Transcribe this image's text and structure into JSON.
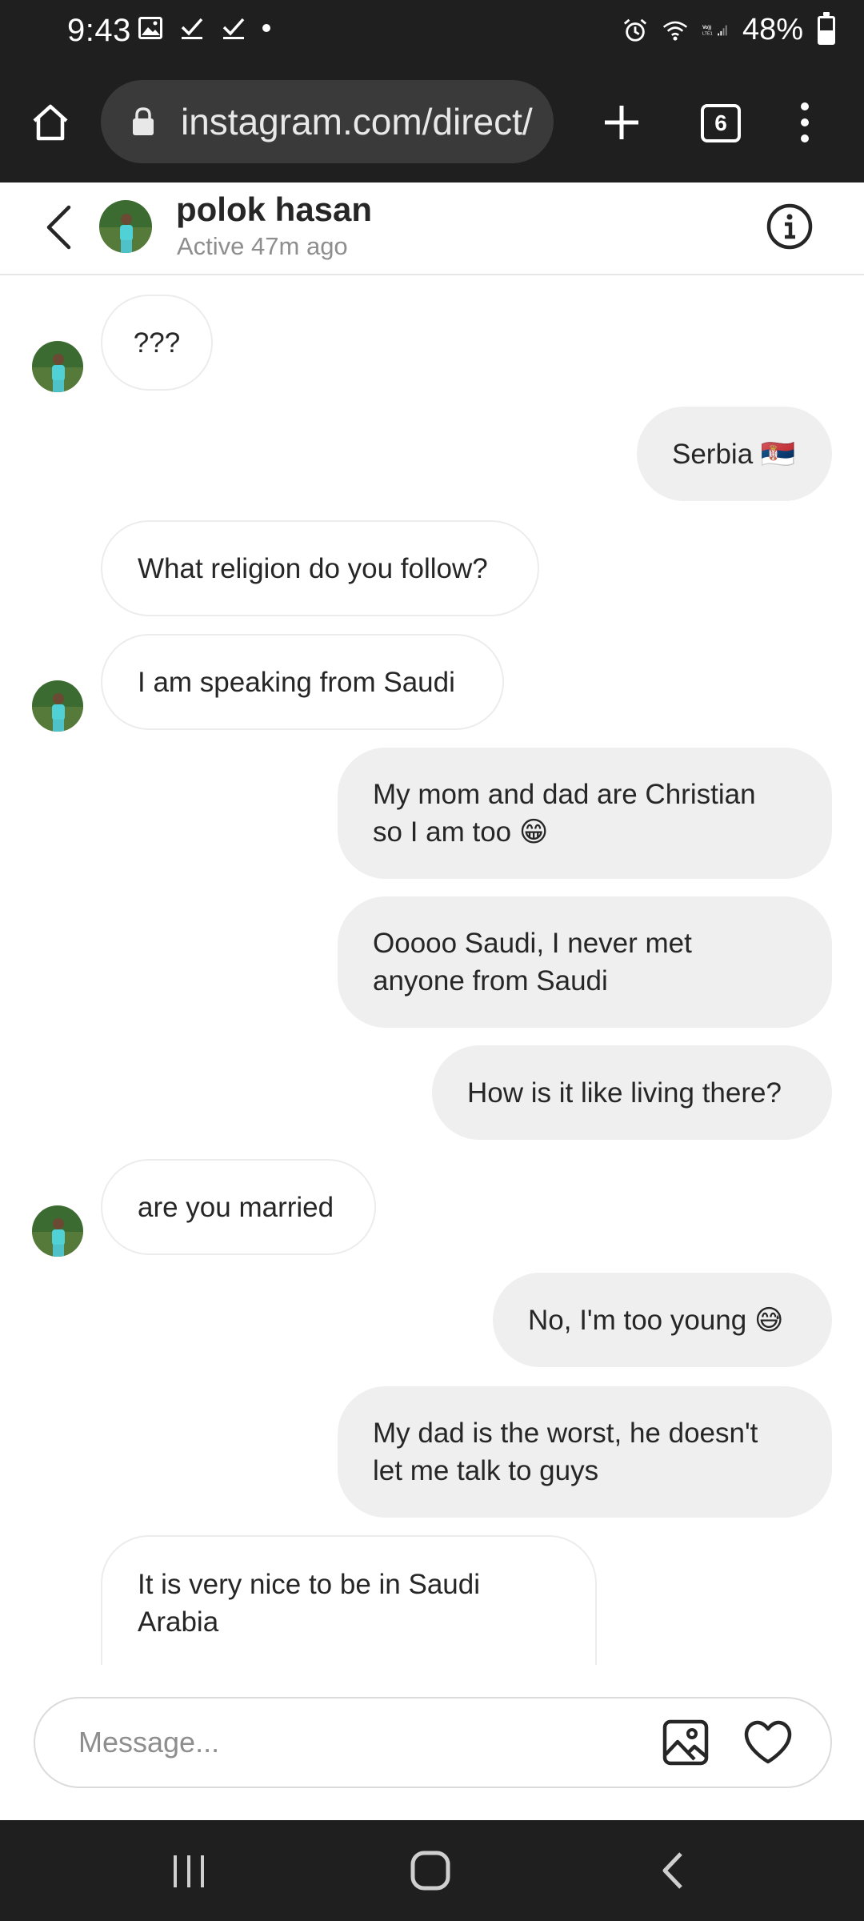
{
  "status_bar": {
    "time": "9:43",
    "battery_percent": "48%",
    "battery_level": 0.48
  },
  "browser": {
    "url": "instagram.com/direct/",
    "tab_count": "6"
  },
  "chat": {
    "name": "polok hasan",
    "status": "Active 47m ago"
  },
  "messages": [
    {
      "side": "in",
      "text": "???"
    },
    {
      "side": "out",
      "text": "Serbia 🇷🇸"
    },
    {
      "side": "in",
      "text": "What religion do you follow?"
    },
    {
      "side": "in",
      "text": "I am speaking from Saudi"
    },
    {
      "side": "out",
      "text": "My mom and dad are Christian\nso I am too 😁"
    },
    {
      "side": "out",
      "text": "Ooooo Saudi, I never met\nanyone from Saudi"
    },
    {
      "side": "out",
      "text": "How is it like living there?"
    },
    {
      "side": "in",
      "text": "are you married"
    },
    {
      "side": "out",
      "text": "No, I'm too young 😅"
    },
    {
      "side": "out",
      "text": "My dad is the worst, he doesn't\nlet me talk to guys"
    },
    {
      "side": "in",
      "text": "It is very nice to be in Saudi\nArabia"
    }
  ],
  "composer": {
    "placeholder": "Message..."
  },
  "colors": {
    "system_bar": "#1f1f1f",
    "bubble_out": "#efefef",
    "bubble_in_border": "#ececec",
    "muted_text": "#8e8e8e"
  }
}
